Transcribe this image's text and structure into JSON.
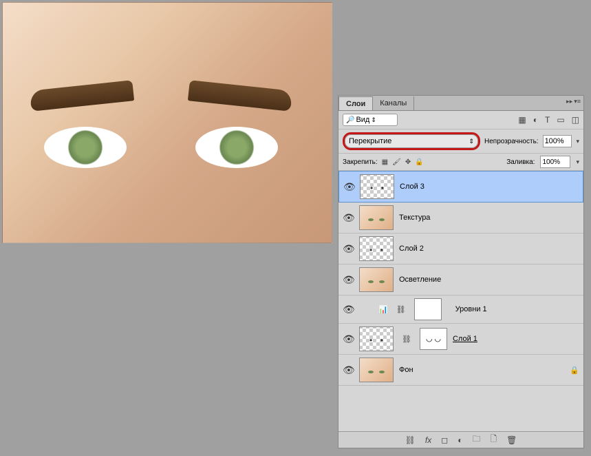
{
  "tabs": {
    "layers": "Слои",
    "channels": "Каналы"
  },
  "filter": {
    "label": "Вид"
  },
  "blend": {
    "value": "Перекрытие",
    "opacity_label": "Непрозрачность:",
    "opacity_value": "100%"
  },
  "lock": {
    "label": "Закрепить:",
    "fill_label": "Заливка:",
    "fill_value": "100%"
  },
  "layers": [
    {
      "name": "Слой 3",
      "thumb": "checker dots",
      "selected": true
    },
    {
      "name": "Текстура",
      "thumb": "face"
    },
    {
      "name": "Слой 2",
      "thumb": "checker dots"
    },
    {
      "name": "Осветление",
      "thumb": "face"
    },
    {
      "name": "Уровни 1",
      "adjustment": true
    },
    {
      "name": "Слой 1",
      "thumb": "checker dots",
      "mask": true,
      "underline": true
    },
    {
      "name": "Фон",
      "thumb": "face",
      "locked": true
    }
  ]
}
